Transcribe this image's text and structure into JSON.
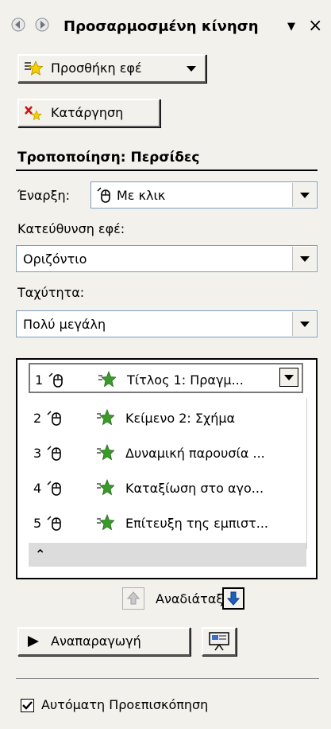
{
  "header": {
    "title": "Προσαρμοσμένη κίνηση",
    "back_icon": "arrow-left-icon",
    "forward_icon": "arrow-right-icon",
    "menu_icon": "chevron-down-icon",
    "close_icon": "close-icon"
  },
  "buttons": {
    "add_effect": "Προσθήκη εφέ",
    "remove": "Κατάργηση",
    "play": "Αναπαραγωγή"
  },
  "modify": {
    "title": "Τροποποίηση: Περσίδες",
    "start_label": "Έναρξη:",
    "start_value": "Με κλικ",
    "direction_label": "Κατεύθυνση εφέ:",
    "direction_value": "Οριζόντιο",
    "speed_label": "Ταχύτητα:",
    "speed_value": "Πολύ μεγάλη"
  },
  "animation_list": {
    "items": [
      {
        "num": "1",
        "label": "Τίτλος 1: Πραγμ..."
      },
      {
        "num": "2",
        "label": "Κείμενο 2: Σχήμα"
      },
      {
        "num": "3",
        "label": "Δυναμική παρουσία ..."
      },
      {
        "num": "4",
        "label": "Καταξίωση στο αγο..."
      },
      {
        "num": "5",
        "label": "Επίτευξη της εμπιστ..."
      }
    ],
    "expand_icon": "double-chevron-icon"
  },
  "reorder": {
    "label": "Αναδιάταξη"
  },
  "autopreview": {
    "label": "Αυτόματη Προεπισκόπηση",
    "checked": true
  },
  "colors": {
    "panel_bg": "#f2f1ec",
    "star_green": "#3a9a2a",
    "star_yellow": "#f5d000",
    "reorder_blue": "#1f5fbf"
  }
}
